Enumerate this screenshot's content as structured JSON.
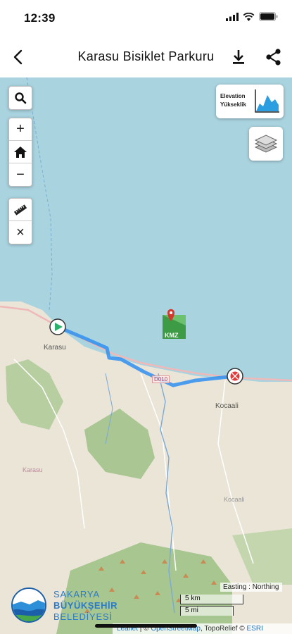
{
  "status": {
    "time": "12:39"
  },
  "nav": {
    "title": "Karasu Bisiklet Parkuru"
  },
  "controls": {
    "zoom_in": "+",
    "zoom_out": "−",
    "clear": "×",
    "elevation_line1": "Elevation",
    "elevation_line2": "Yükseklik"
  },
  "map": {
    "place_karasu": "Karasu",
    "place_kocaali": "Kocaali",
    "place_karasu_small": "Karasu",
    "place_kocaali_small": "Kocaali",
    "road_label": "D010",
    "kmz_label": "KMZ",
    "route_color": "#2f8ff0",
    "sea_color": "#a9d3df"
  },
  "logo": {
    "line1": "SAKARYA",
    "line2": "BÜYÜKŞEHİR",
    "line3": "BELEDİYESİ"
  },
  "scale": {
    "km": "5 km",
    "mi": "5 mi",
    "easting": "Easting : Northing"
  },
  "attribution": {
    "leaflet": "Leaflet",
    "sep": " | © ",
    "osm": "OpenStreetMap",
    "topo": ", TopoRelief © ",
    "esri": "ESRI"
  }
}
